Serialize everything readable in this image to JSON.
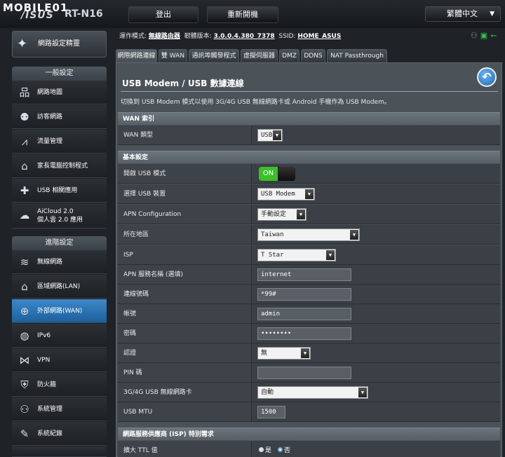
{
  "header": {
    "brand_text": "MOBILE01",
    "logo": "/ISUS",
    "model": "RT-N16",
    "logout_label": "登出",
    "reboot_label": "重新開機",
    "language": "繁體中文"
  },
  "info_bar": {
    "op_mode_label": "運作模式:",
    "op_mode": "無線路由器",
    "firmware_label": "韌體版本:",
    "firmware": "3.0.0.4.380_7378",
    "ssid_label": "SSID:",
    "ssid": "HOME_ASUS"
  },
  "sidebar": {
    "qis_label": "網路設定精靈",
    "general_title": "一般設定",
    "general_items": [
      {
        "label": "網路地圖",
        "icon": "network-map-icon"
      },
      {
        "label": "訪客網路",
        "icon": "guest-network-icon"
      },
      {
        "label": "流量管理",
        "icon": "traffic-icon"
      },
      {
        "label": "家長電腦控制程式",
        "icon": "parental-icon"
      },
      {
        "label": "USB 相關應用",
        "icon": "usb-app-icon"
      },
      {
        "label": "AiCloud 2.0",
        "label2": "個人雲 2.0 應用",
        "icon": "cloud-icon"
      }
    ],
    "advanced_title": "進階設定",
    "advanced_items": [
      {
        "label": "無線網路",
        "icon": "wireless-icon"
      },
      {
        "label": "區域網路(LAN)",
        "icon": "lan-icon"
      },
      {
        "label": "外部網路(WAN)",
        "icon": "wan-icon",
        "active": true
      },
      {
        "label": "IPv6",
        "icon": "ipv6-icon"
      },
      {
        "label": "VPN",
        "icon": "vpn-icon"
      },
      {
        "label": "防火牆",
        "icon": "firewall-icon"
      },
      {
        "label": "系統管理",
        "icon": "admin-icon"
      },
      {
        "label": "系統紀錄",
        "icon": "log-icon"
      }
    ]
  },
  "tabs": [
    {
      "label": "網際網路連線",
      "active": true
    },
    {
      "label": "雙 WAN"
    },
    {
      "label": "通訊埠觸發程式"
    },
    {
      "label": "虛擬伺服器"
    },
    {
      "label": "DMZ"
    },
    {
      "label": "DDNS"
    },
    {
      "label": "NAT Passthrough"
    }
  ],
  "main": {
    "title": "USB Modem / USB 數據連線",
    "description": "切換到 USB Modem 模式以使用 3G/4G USB 無線網路卡或 Android 手機作為 USB Modem。",
    "wan_index_head": "WAN 索引",
    "wan_type_label": "WAN 類型",
    "wan_type_value": "USB",
    "basic_head": "基本設定",
    "enable_usb_label": "開啟 USB 模式",
    "enable_usb_value": "ON",
    "usb_device_label": "選擇 USB 裝置",
    "usb_device_value": "USB Modem",
    "apn_config_label": "APN Configuration",
    "apn_config_value": "手動設定",
    "location_label": "所在地區",
    "location_value": "Taiwan",
    "isp_label": "ISP",
    "isp_value": "T Star",
    "apn_name_label": "APN 服務名稱 (選填)",
    "apn_name_value": "internet",
    "dial_label": "連線號碼",
    "dial_value": "*99#",
    "account_label": "帳號",
    "account_value": "admin",
    "password_label": "密碼",
    "password_value": "••••••••",
    "auth_label": "認證",
    "auth_value": "無",
    "pin_label": "PIN 碼",
    "pin_value": "",
    "adapter_label": "3G/4G USB 無線網路卡",
    "adapter_value": "自動",
    "mtu_label": "USB MTU",
    "mtu_value": "1500",
    "isp_special_head": "網路服務供應商 (ISP) 特別需求",
    "ttl_label": "擴大 TTL 值",
    "ttl_yes": "是",
    "ttl_no": "否"
  }
}
